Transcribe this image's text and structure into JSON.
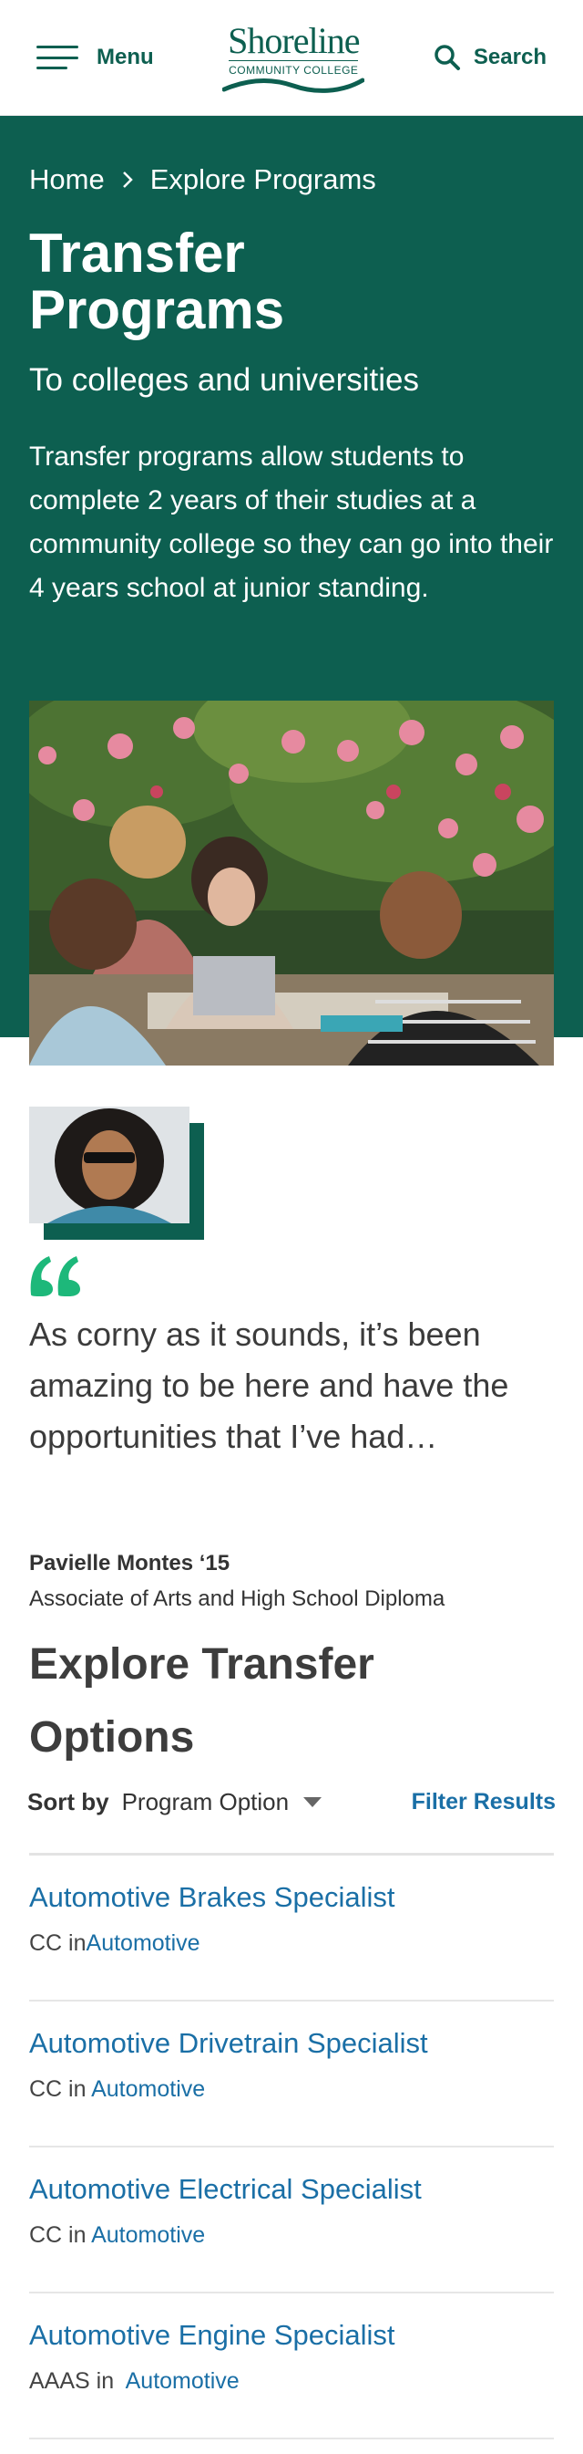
{
  "header": {
    "menu_label": "Menu",
    "logo_name": "Shoreline",
    "logo_sub": "COMMUNITY COLLEGE",
    "search_label": "Search"
  },
  "breadcrumb": {
    "home": "Home",
    "current": "Explore Programs"
  },
  "hero": {
    "title": "Transfer Programs",
    "subtitle": "To colleges and universities",
    "intro": "Transfer programs allow students to complete 2 years of their studies at a community college so they can go into their 4 years school at junior standing."
  },
  "testimonial": {
    "quote": "As corny as it sounds, it’s been amazing to be here and have the opportunities that I’ve had…",
    "name": "Pavielle Montes ‘15",
    "role": "Associate of Arts and High School Diploma"
  },
  "explore": {
    "title": "Explore Transfer Options",
    "sort_label": "Sort by",
    "sort_value": "Program Option",
    "filter_label": "Filter Results"
  },
  "programs": [
    {
      "name": "Automotive Brakes Specialist",
      "prefix": "CC in",
      "area": "Automotive"
    },
    {
      "name": "Automotive Drivetrain Specialist",
      "prefix": "CC in ",
      "area": "Automotive"
    },
    {
      "name": "Automotive Electrical Specialist",
      "prefix": "CC in ",
      "area": "Automotive"
    },
    {
      "name": "Automotive Engine Specialist",
      "prefix": "AAAS in  ",
      "area": "Automotive"
    }
  ],
  "colors": {
    "brand_green": "#0d5f50",
    "link_blue": "#1a6fa6",
    "quote_accent": "#1db87a"
  }
}
